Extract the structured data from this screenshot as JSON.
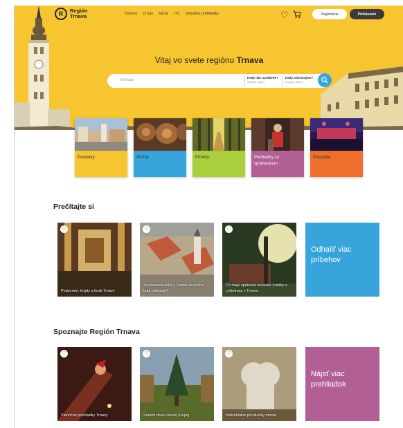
{
  "brand": {
    "name": "Región Trnava",
    "mark": "R"
  },
  "nav": {
    "items": [
      "Domov",
      "O nás",
      "MICE",
      "TIC",
      "Virtuálne prehliadky"
    ],
    "heart_icon": "heart-icon",
    "cart_icon": "cart-icon",
    "register_label": "Registrácia",
    "login_label": "Prihlásenie"
  },
  "hero": {
    "title_prefix": "Vitaj vo svete regiónu ",
    "title_bold": "Trnava",
    "bg_color": "#f7c52f"
  },
  "search": {
    "placeholder": "Vyhľadať",
    "arrival_label": "Kedy nás navštívite?",
    "arrival_value": "Zadajte dátum",
    "departure_label": "Kedy odcestujete?",
    "departure_value": "Zadajte dátum",
    "button_icon": "search-icon"
  },
  "categories": [
    {
      "label": "Pamiatky",
      "color": "#f7c52f"
    },
    {
      "label": "Služby",
      "color": "#37a5dc"
    },
    {
      "label": "Príroda",
      "color": "#a9cf3c"
    },
    {
      "label": "Prehliadky so sprievodcom",
      "color": "#b15f95"
    },
    {
      "label": "Podujatia",
      "color": "#f06e2d"
    }
  ],
  "read": {
    "title": "Prečítajte si",
    "cards": [
      "Podzemie, krypty a kosti Trnavy",
      "Je mestská veža v Trnave skutočne taká unikátna?",
      "Čo majú spoločné mestské hradby a cyklotrasy v Trnave"
    ],
    "more_label": "Odhaliť viac príbehov",
    "more_color": "#37a5dc"
  },
  "explore": {
    "title": "Spoznajte Región Trnava",
    "cards": [
      "Vianočné prehliadky Trnavy",
      "Sedem divov Dolnej Krupej",
      "Individuálne prehliadky mesta"
    ],
    "more_label": "Nájsť viac prehliadok",
    "more_color": "#b15f95"
  }
}
